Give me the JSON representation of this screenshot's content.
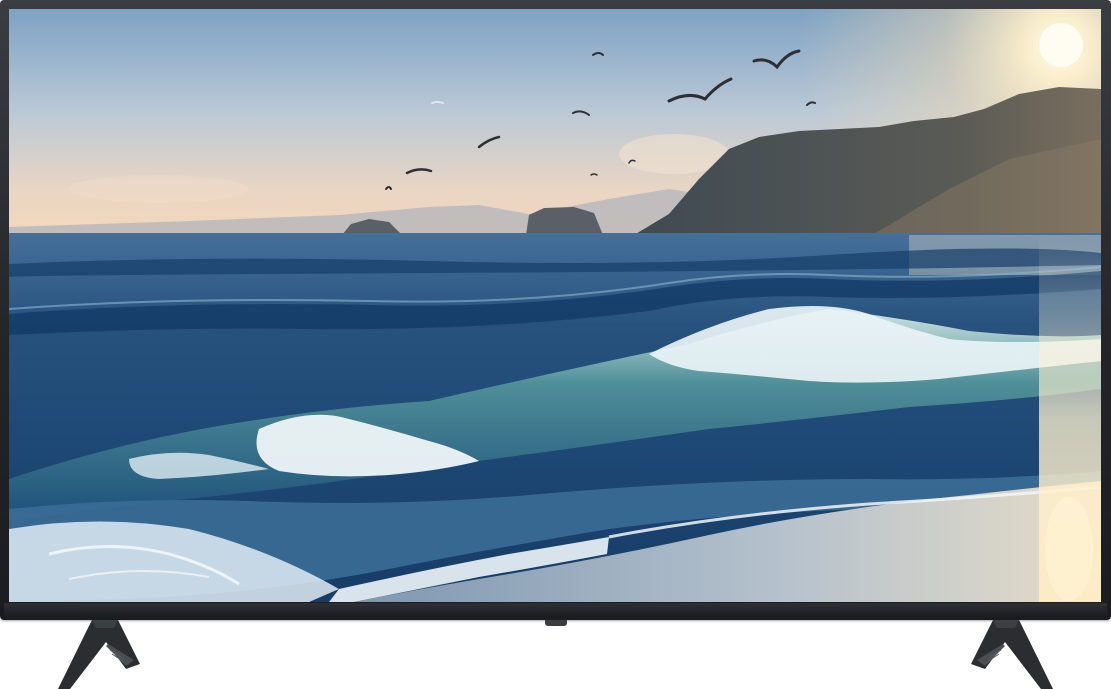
{
  "device": {
    "type": "television",
    "icons": {
      "stand_left": "tv-stand-leg-icon",
      "stand_right": "tv-stand-leg-icon",
      "ir_sensor": "ir-sensor-icon"
    }
  },
  "screen_image": {
    "scene": "ocean-waves-at-sunrise",
    "icons": [
      "sun-icon",
      "bird-icon",
      "mountain-icon",
      "wave-icon"
    ]
  },
  "colors": {
    "bezel": "#232529",
    "sky_top": "#7fa3c4",
    "sky_horizon": "#f3d9bd",
    "sea_deep": "#0f2e55",
    "sea_mid": "#3a6b93",
    "wave_crest": "#e8f2f7",
    "sand": "#c9d3dc",
    "sun": "#fff6d8"
  }
}
